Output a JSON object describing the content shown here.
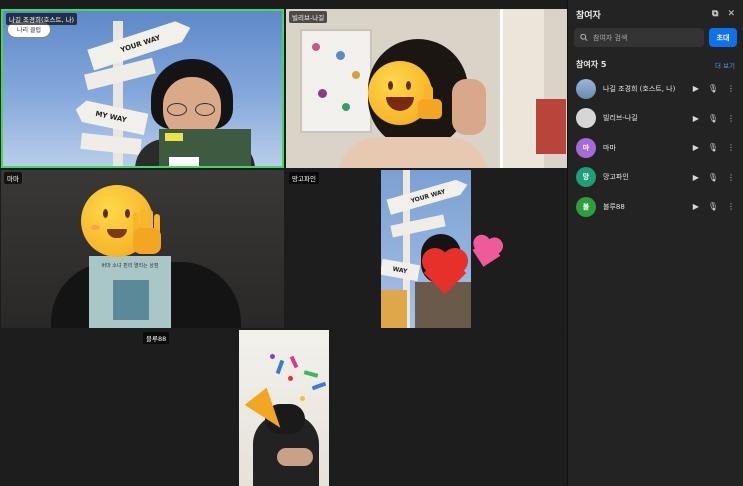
{
  "tiles": [
    {
      "name": "나길 조경희(호스트, 나)",
      "cloud_text": "나리 클럽",
      "sign_top": "YOUR WAY",
      "sign_bottom": "MY WAY"
    },
    {
      "name": "빌리브-나길"
    },
    {
      "name": "마마",
      "book_text": "버마 소녀 핀리 열리는 상점"
    },
    {
      "name": "망고파인",
      "sign_top": "YOUR WAY",
      "sign_bottom": "WAY"
    },
    {
      "name": "블루88"
    }
  ],
  "sidebar": {
    "title": "참여자",
    "search_placeholder": "참여자 검색",
    "invite_label": "초대",
    "count_label": "참여자 5",
    "more_label": "더 보기",
    "participants": [
      {
        "name": "나길 조경희 (호스트, 나)",
        "initial": "",
        "color": "#8aa6c8"
      },
      {
        "name": "빌리브-나길",
        "initial": "",
        "color": "#bdbdbd"
      },
      {
        "name": "마마",
        "initial": "마",
        "color": "#a56bd6"
      },
      {
        "name": "망고파인",
        "initial": "망",
        "color": "#1f9e78"
      },
      {
        "name": "블루88",
        "initial": "블",
        "color": "#2e9e3e"
      }
    ]
  },
  "colors": {
    "active_speaker": "#3ddc5f",
    "accent": "#0e72ed"
  }
}
